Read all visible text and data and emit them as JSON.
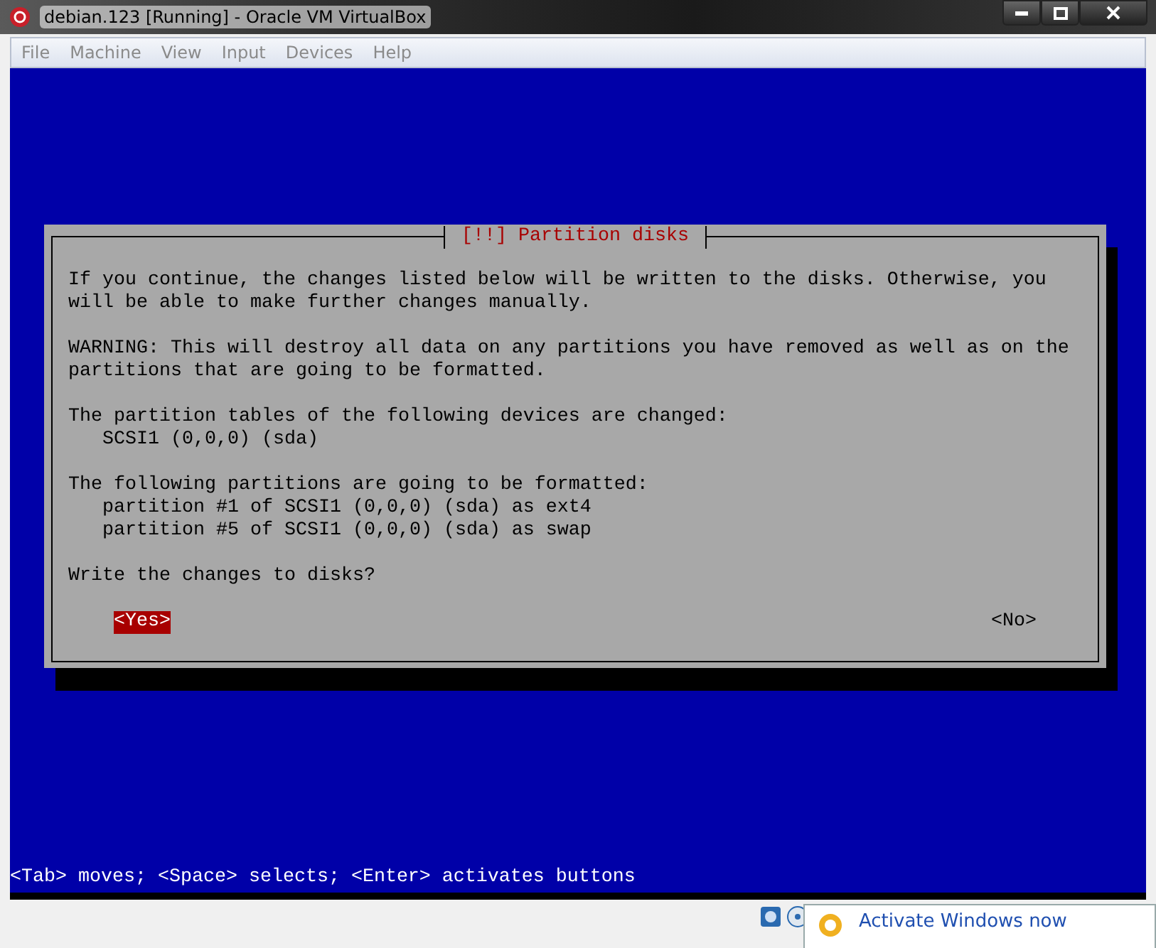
{
  "window": {
    "title": "debian.123 [Running] - Oracle VM VirtualBox"
  },
  "menu": [
    "File",
    "Machine",
    "View",
    "Input",
    "Devices",
    "Help"
  ],
  "dialog": {
    "title": "[!!] Partition disks",
    "lines": [
      {
        "kind": "text",
        "text": "If you continue, the changes listed below will be written to the disks. Otherwise, you"
      },
      {
        "kind": "text",
        "text": "will be able to make further changes manually."
      },
      {
        "kind": "blank"
      },
      {
        "kind": "text",
        "text": "WARNING: This will destroy all data on any partitions you have removed as well as on the"
      },
      {
        "kind": "text",
        "text": "partitions that are going to be formatted."
      },
      {
        "kind": "blank"
      },
      {
        "kind": "text",
        "text": "The partition tables of the following devices are changed:"
      },
      {
        "kind": "item",
        "text": "SCSI1 (0,0,0) (sda)"
      },
      {
        "kind": "blank"
      },
      {
        "kind": "text",
        "text": "The following partitions are going to be formatted:"
      },
      {
        "kind": "item",
        "text": "partition #1 of SCSI1 (0,0,0) (sda) as ext4"
      },
      {
        "kind": "item",
        "text": "partition #5 of SCSI1 (0,0,0) (sda) as swap"
      },
      {
        "kind": "blank"
      },
      {
        "kind": "text",
        "text": "Write the changes to disks?"
      }
    ],
    "buttons": [
      {
        "label": "<Yes>",
        "selected": true
      },
      {
        "label": "<No>",
        "selected": false
      }
    ]
  },
  "help_line": "<Tab> moves; <Space> selects; <Enter> activates buttons",
  "notification": {
    "text": "Activate Windows now"
  }
}
